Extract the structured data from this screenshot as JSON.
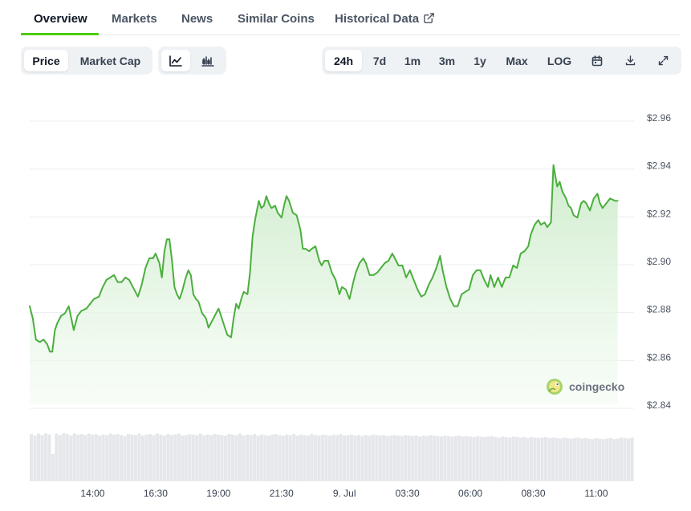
{
  "tabs": [
    {
      "label": "Overview",
      "active": true
    },
    {
      "label": "Markets"
    },
    {
      "label": "News"
    },
    {
      "label": "Similar Coins"
    },
    {
      "label": "Historical Data",
      "icon": "external-link-icon"
    }
  ],
  "toolbar_left": {
    "data_type": [
      "Price",
      "Market Cap"
    ],
    "selected": "Price",
    "chart_types": [
      {
        "name": "line-chart-icon",
        "selected": true
      },
      {
        "name": "candlestick-chart-icon",
        "selected": false
      }
    ]
  },
  "toolbar_right": {
    "ranges": [
      "24h",
      "7d",
      "1m",
      "3m",
      "1y",
      "Max",
      "LOG"
    ],
    "selected": "24h",
    "icons": [
      "calendar-icon",
      "download-icon",
      "expand-icon"
    ]
  },
  "colors": {
    "line": "#4bae3e",
    "fill_top": "#d8f0d6",
    "grid": "#e9ecef",
    "volume": "#e5e7eb",
    "accent": "#4bcc00"
  },
  "watermark": {
    "text": "coingecko",
    "icon": "coingecko-logo-icon"
  },
  "chart_data": {
    "type": "area",
    "x_unit": "hours since 11:00 (8 Jul)",
    "y_ticks": [
      {
        "value": 2.96,
        "label": "$2.96"
      },
      {
        "value": 2.94,
        "label": "$2.94"
      },
      {
        "value": 2.92,
        "label": "$2.92"
      },
      {
        "value": 2.9,
        "label": "$2.90"
      },
      {
        "value": 2.88,
        "label": "$2.88"
      },
      {
        "value": 2.86,
        "label": "$2.86"
      },
      {
        "value": 2.84,
        "label": "$2.84"
      }
    ],
    "ylim": [
      2.84,
      2.96
    ],
    "xlim": [
      0,
      24
    ],
    "x_ticks": [
      {
        "x": 2.5,
        "label": "14:00"
      },
      {
        "x": 5,
        "label": "16:30"
      },
      {
        "x": 7.5,
        "label": "19:00"
      },
      {
        "x": 10,
        "label": "21:30"
      },
      {
        "x": 12.5,
        "label": "9. Jul"
      },
      {
        "x": 15,
        "label": "03:30"
      },
      {
        "x": 17.5,
        "label": "06:00"
      },
      {
        "x": 20,
        "label": "08:30"
      },
      {
        "x": 22.5,
        "label": "11:00"
      }
    ],
    "series": [
      {
        "values": [
          [
            0.0,
            2.881
          ],
          [
            0.12,
            2.876
          ],
          [
            0.25,
            2.867
          ],
          [
            0.4,
            2.866
          ],
          [
            0.55,
            2.867
          ],
          [
            0.7,
            2.865
          ],
          [
            0.8,
            2.862
          ],
          [
            0.9,
            2.862
          ],
          [
            1.0,
            2.871
          ],
          [
            1.1,
            2.874
          ],
          [
            1.25,
            2.877
          ],
          [
            1.4,
            2.878
          ],
          [
            1.55,
            2.881
          ],
          [
            1.65,
            2.876
          ],
          [
            1.75,
            2.871
          ],
          [
            1.9,
            2.877
          ],
          [
            2.05,
            2.879
          ],
          [
            2.25,
            2.88
          ],
          [
            2.4,
            2.882
          ],
          [
            2.55,
            2.884
          ],
          [
            2.75,
            2.885
          ],
          [
            2.9,
            2.889
          ],
          [
            3.05,
            2.892
          ],
          [
            3.2,
            2.893
          ],
          [
            3.35,
            2.894
          ],
          [
            3.5,
            2.891
          ],
          [
            3.65,
            2.891
          ],
          [
            3.8,
            2.893
          ],
          [
            3.95,
            2.892
          ],
          [
            4.1,
            2.889
          ],
          [
            4.3,
            2.885
          ],
          [
            4.45,
            2.89
          ],
          [
            4.6,
            2.897
          ],
          [
            4.75,
            2.901
          ],
          [
            4.9,
            2.901
          ],
          [
            5.0,
            2.903
          ],
          [
            5.15,
            2.899
          ],
          [
            5.25,
            2.893
          ],
          [
            5.35,
            2.904
          ],
          [
            5.45,
            2.909
          ],
          [
            5.55,
            2.909
          ],
          [
            5.65,
            2.9
          ],
          [
            5.75,
            2.889
          ],
          [
            5.85,
            2.886
          ],
          [
            5.95,
            2.884
          ],
          [
            6.05,
            2.887
          ],
          [
            6.2,
            2.893
          ],
          [
            6.3,
            2.896
          ],
          [
            6.4,
            2.894
          ],
          [
            6.5,
            2.886
          ],
          [
            6.6,
            2.884
          ],
          [
            6.7,
            2.883
          ],
          [
            6.85,
            2.878
          ],
          [
            7.0,
            2.876
          ],
          [
            7.1,
            2.872
          ],
          [
            7.25,
            2.875
          ],
          [
            7.4,
            2.878
          ],
          [
            7.5,
            2.88
          ],
          [
            7.6,
            2.877
          ],
          [
            7.75,
            2.872
          ],
          [
            7.85,
            2.869
          ],
          [
            8.0,
            2.868
          ],
          [
            8.1,
            2.876
          ],
          [
            8.2,
            2.882
          ],
          [
            8.3,
            2.88
          ],
          [
            8.4,
            2.884
          ],
          [
            8.5,
            2.887
          ],
          [
            8.65,
            2.886
          ],
          [
            8.75,
            2.895
          ],
          [
            8.85,
            2.91
          ],
          [
            8.95,
            2.917
          ],
          [
            9.1,
            2.925
          ],
          [
            9.2,
            2.922
          ],
          [
            9.3,
            2.923
          ],
          [
            9.4,
            2.927
          ],
          [
            9.5,
            2.924
          ],
          [
            9.6,
            2.922
          ],
          [
            9.75,
            2.923
          ],
          [
            9.85,
            2.92
          ],
          [
            10.0,
            2.918
          ],
          [
            10.1,
            2.923
          ],
          [
            10.2,
            2.927
          ],
          [
            10.3,
            2.925
          ],
          [
            10.45,
            2.92
          ],
          [
            10.6,
            2.919
          ],
          [
            10.75,
            2.913
          ],
          [
            10.85,
            2.905
          ],
          [
            10.95,
            2.905
          ],
          [
            11.1,
            2.904
          ],
          [
            11.2,
            2.905
          ],
          [
            11.35,
            2.906
          ],
          [
            11.5,
            2.9
          ],
          [
            11.6,
            2.898
          ],
          [
            11.7,
            2.9
          ],
          [
            11.85,
            2.9
          ],
          [
            12.0,
            2.895
          ],
          [
            12.15,
            2.892
          ],
          [
            12.3,
            2.886
          ],
          [
            12.4,
            2.889
          ],
          [
            12.55,
            2.888
          ],
          [
            12.7,
            2.884
          ],
          [
            12.85,
            2.891
          ],
          [
            12.95,
            2.895
          ],
          [
            13.1,
            2.899
          ],
          [
            13.25,
            2.901
          ],
          [
            13.35,
            2.899
          ],
          [
            13.5,
            2.894
          ],
          [
            13.65,
            2.894
          ],
          [
            13.8,
            2.895
          ],
          [
            13.95,
            2.897
          ],
          [
            14.1,
            2.899
          ],
          [
            14.25,
            2.9
          ],
          [
            14.4,
            2.903
          ],
          [
            14.55,
            2.9
          ],
          [
            14.65,
            2.898
          ],
          [
            14.8,
            2.898
          ],
          [
            14.95,
            2.893
          ],
          [
            15.1,
            2.896
          ],
          [
            15.25,
            2.892
          ],
          [
            15.4,
            2.888
          ],
          [
            15.55,
            2.885
          ],
          [
            15.7,
            2.886
          ],
          [
            15.85,
            2.89
          ],
          [
            16.0,
            2.893
          ],
          [
            16.15,
            2.897
          ],
          [
            16.3,
            2.902
          ],
          [
            16.4,
            2.896
          ],
          [
            16.55,
            2.889
          ],
          [
            16.7,
            2.884
          ],
          [
            16.85,
            2.881
          ],
          [
            17.0,
            2.881
          ],
          [
            17.15,
            2.886
          ],
          [
            17.3,
            2.887
          ],
          [
            17.45,
            2.888
          ],
          [
            17.6,
            2.894
          ],
          [
            17.75,
            2.896
          ],
          [
            17.9,
            2.896
          ],
          [
            18.05,
            2.892
          ],
          [
            18.2,
            2.889
          ],
          [
            18.3,
            2.894
          ],
          [
            18.45,
            2.889
          ],
          [
            18.6,
            2.893
          ],
          [
            18.75,
            2.889
          ],
          [
            18.9,
            2.893
          ],
          [
            19.05,
            2.893
          ],
          [
            19.2,
            2.898
          ],
          [
            19.35,
            2.897
          ],
          [
            19.5,
            2.903
          ],
          [
            19.65,
            2.904
          ],
          [
            19.8,
            2.906
          ],
          [
            19.9,
            2.911
          ],
          [
            20.05,
            2.915
          ],
          [
            20.2,
            2.917
          ],
          [
            20.3,
            2.915
          ],
          [
            20.45,
            2.916
          ],
          [
            20.55,
            2.914
          ],
          [
            20.7,
            2.916
          ],
          [
            20.8,
            2.94
          ],
          [
            20.9,
            2.934
          ],
          [
            20.95,
            2.931
          ],
          [
            21.05,
            2.933
          ],
          [
            21.15,
            2.929
          ],
          [
            21.3,
            2.926
          ],
          [
            21.4,
            2.923
          ],
          [
            21.5,
            2.922
          ],
          [
            21.6,
            2.919
          ],
          [
            21.75,
            2.918
          ],
          [
            21.9,
            2.924
          ],
          [
            22.0,
            2.925
          ],
          [
            22.1,
            2.924
          ],
          [
            22.25,
            2.921
          ],
          [
            22.4,
            2.926
          ],
          [
            22.55,
            2.928
          ],
          [
            22.65,
            2.924
          ],
          [
            22.75,
            2.922
          ],
          [
            22.9,
            2.924
          ],
          [
            23.05,
            2.926
          ],
          [
            23.25,
            2.925
          ],
          [
            23.35,
            2.925
          ]
        ]
      }
    ],
    "volume": {
      "note": "relative bar heights (0-1) across the window",
      "values": [
        0.95,
        0.92,
        0.96,
        0.93,
        0.97,
        0.94,
        0.55,
        0.96,
        0.93,
        0.97,
        0.95,
        0.92,
        0.96,
        0.94,
        0.95,
        0.93,
        0.96,
        0.94,
        0.95,
        0.92,
        0.94,
        0.93,
        0.96,
        0.94,
        0.95,
        0.93,
        0.91,
        0.95,
        0.94,
        0.93,
        0.96,
        0.92,
        0.94,
        0.95,
        0.93,
        0.96,
        0.94,
        0.92,
        0.95,
        0.93,
        0.94,
        0.96,
        0.92,
        0.93,
        0.95,
        0.94,
        0.93,
        0.96,
        0.92,
        0.94,
        0.93,
        0.95,
        0.94,
        0.93,
        0.92,
        0.95,
        0.94,
        0.93,
        0.96,
        0.92,
        0.94,
        0.93,
        0.95,
        0.92,
        0.94,
        0.93,
        0.92,
        0.94,
        0.95,
        0.93,
        0.92,
        0.94,
        0.93,
        0.95,
        0.92,
        0.94,
        0.93,
        0.92,
        0.95,
        0.93,
        0.92,
        0.94,
        0.93,
        0.92,
        0.94,
        0.93,
        0.95,
        0.92,
        0.93,
        0.94,
        0.92,
        0.93,
        0.91,
        0.93,
        0.92,
        0.94,
        0.93,
        0.92,
        0.93,
        0.91,
        0.92,
        0.93,
        0.92,
        0.91,
        0.93,
        0.92,
        0.91,
        0.92,
        0.9,
        0.92,
        0.91,
        0.93,
        0.92,
        0.91,
        0.9,
        0.92,
        0.91,
        0.9,
        0.91,
        0.92,
        0.9,
        0.91,
        0.9,
        0.89,
        0.91,
        0.9,
        0.89,
        0.9,
        0.91,
        0.89,
        0.88,
        0.9,
        0.89,
        0.88,
        0.9,
        0.89,
        0.88,
        0.89,
        0.87,
        0.89,
        0.88,
        0.87,
        0.88,
        0.89,
        0.87,
        0.88,
        0.87,
        0.86,
        0.88,
        0.87,
        0.86,
        0.87,
        0.88,
        0.86,
        0.87,
        0.86,
        0.85,
        0.87,
        0.86,
        0.85,
        0.86,
        0.87,
        0.85,
        0.86,
        0.88,
        0.87,
        0.86,
        0.88
      ]
    }
  }
}
